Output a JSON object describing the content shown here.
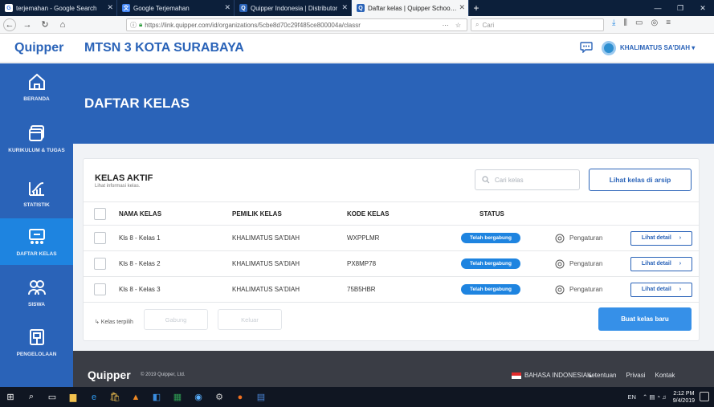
{
  "browser": {
    "tabs": [
      {
        "label": "terjemahan - Google Search",
        "icon": "google-icon",
        "color": "#4285f4"
      },
      {
        "label": "Google Terjemahan",
        "icon": "translate-icon",
        "color": "#4285f4"
      },
      {
        "label": "Quipper Indonesia | Distributor",
        "icon": "quipper-icon",
        "color": "#2a63b8"
      },
      {
        "label": "Daftar kelas | Quipper School L",
        "icon": "quipper-icon",
        "color": "#2a63b8"
      }
    ],
    "active_tab_index": 3,
    "url": "https://link.quipper.com/id/organizations/5cbe8d70c29f485ce800004a/classr",
    "url_domain": "quipper.com",
    "search_placeholder": "Cari"
  },
  "header": {
    "logo": "Quipper",
    "school_name": "MTSN 3 KOTA SURABAYA",
    "user_name": "KHALIMATUS SA'DIAH ▾"
  },
  "sidebar": {
    "items": [
      {
        "label": "BERANDA",
        "icon": "home-icon",
        "active": false
      },
      {
        "label": "KURIKULUM & TUGAS",
        "icon": "curriculum-icon",
        "active": false
      },
      {
        "label": "STATISTIK",
        "icon": "statistics-icon",
        "active": false
      },
      {
        "label": "DAFTAR KELAS",
        "icon": "class-list-icon",
        "active": true
      },
      {
        "label": "SISWA",
        "icon": "students-icon",
        "active": false
      },
      {
        "label": "PENGELOLAAN",
        "icon": "management-icon",
        "active": false
      }
    ]
  },
  "main": {
    "page_title": "DAFTAR KELAS",
    "card_title": "KELAS AKTIF",
    "card_subtitle": "Lihat informasi kelas.",
    "search_placeholder": "Cari kelas",
    "archive_button": "Lihat kelas di arsip",
    "columns": [
      "NAMA KELAS",
      "PEMILIK KELAS",
      "KODE KELAS",
      "STATUS"
    ],
    "rows": [
      {
        "name": "Kls 8 - Kelas 1",
        "owner": "KHALIMATUS SA'DIAH",
        "code": "WXPPLMR",
        "status": "Telah bergabung",
        "settings": "Pengaturan",
        "detail": "Lihat detail"
      },
      {
        "name": "Kls 8 - Kelas 2",
        "owner": "KHALIMATUS SA'DIAH",
        "code": "PX8MP78",
        "status": "Telah bergabung",
        "settings": "Pengaturan",
        "detail": "Lihat detail"
      },
      {
        "name": "Kls 8 - Kelas 3",
        "owner": "KHALIMATUS SA'DIAH",
        "code": "75B5HBR",
        "status": "Telah bergabung",
        "settings": "Pengaturan",
        "detail": "Lihat detail"
      }
    ],
    "selected_label": "↳ Kelas terpilih",
    "join_button": "Gabung",
    "leave_button": "Keluar",
    "new_class_button": "Buat kelas baru"
  },
  "footer": {
    "logo": "Quipper",
    "copyright": "© 2019 Quipper, Ltd.",
    "language": "BAHASA INDONESIA ▴",
    "links": [
      "Ketentuan",
      "Privasi",
      "Kontak"
    ]
  },
  "taskbar": {
    "lang": "EN",
    "time": "2:12 PM",
    "date": "9/4/2019"
  },
  "colors": {
    "brand_blue": "#2a63b8",
    "active_blue": "#1e84e0",
    "footer_bg": "#3a3d45"
  }
}
